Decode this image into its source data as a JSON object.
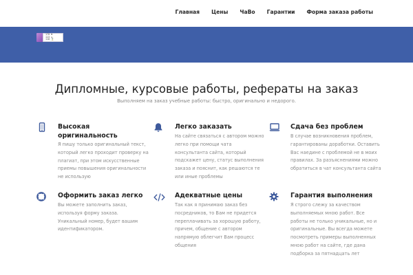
{
  "nav": {
    "items": [
      "Главная",
      "Цены",
      "ЧаВо",
      "Гарантии",
      "Форма заказа работы"
    ]
  },
  "logo": {
    "lines": [
      "170 ▼",
      "113 ☑",
      "110 ⌛"
    ]
  },
  "hero": {
    "title": "Дипломные, курсовые работы, рефераты на заказ",
    "subtitle": "Выполняем на заказ учебные работы: быстро, оригинально и недорого."
  },
  "colors": {
    "banner": "#3f5fa8",
    "accent": "#3e5a9c"
  },
  "features": [
    {
      "icon": "mobile-icon",
      "title": "Высокая оригинальность",
      "text": "Я пишу только оригинальный текст, который легко проходит проверку на плагиат, при этом искусственные приемы повышения оригинальности не использую"
    },
    {
      "icon": "bell-icon",
      "title": "Легко заказать",
      "text": "На сайте связаться с автором можно легко при помощи чата консультанта сайта, который подскажет цену, статус выполнения заказа и пояснит, как решаются те или иные проблемы"
    },
    {
      "icon": "laptop-icon",
      "title": "Сдача без проблем",
      "text": "В случае возникновения проблем, гарантированы доработки. Оставить Вас наедине с проблемой не в моих правилах. За разъяснениями можно обратиться в чат консультанта сайта"
    },
    {
      "icon": "lifebuoy-icon",
      "title": "Оформить заказ легко",
      "text": "Вы можете заполнить заказ, используя форму заказа. Уникальный номер, будет вашим идентификатором."
    },
    {
      "icon": "code-icon",
      "title": "Адекватные цены",
      "text": "Так как я принимаю заказ без посредников, то Вам не придется переплачивать за хорошую работу, причем, общение с автором напрямую облегчит Вам процесс общения"
    },
    {
      "icon": "gear-icon",
      "title": "Гарантия выполнения",
      "text": "Я строго слежу за качеством выполняемых мною работ. Все работы не только уникальные, но и оригинальные. Вы всегда можете посмотреть примеры выполненных мною работ на сайте, где дана подборка за пятнадцать лет"
    }
  ]
}
